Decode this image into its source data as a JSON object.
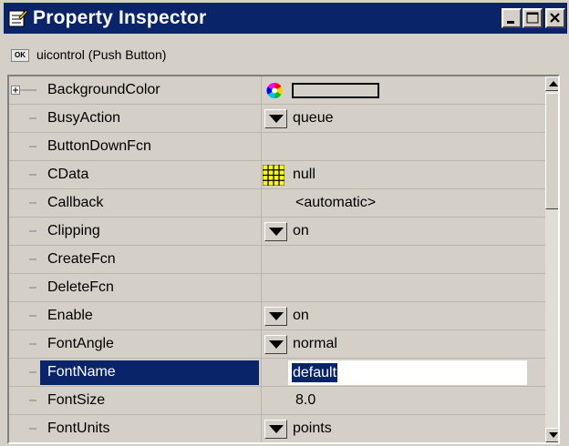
{
  "window": {
    "title": "Property Inspector"
  },
  "object": {
    "label": "uicontrol (Push Button)",
    "icon_text": "OK"
  },
  "properties": [
    {
      "name": "BackgroundColor",
      "value": "",
      "control": "color"
    },
    {
      "name": "BusyAction",
      "value": "queue",
      "control": "dropdown"
    },
    {
      "name": "ButtonDownFcn",
      "value": "",
      "control": "none"
    },
    {
      "name": "CData",
      "value": "null",
      "control": "grid"
    },
    {
      "name": "Callback",
      "value": "<automatic>",
      "control": "none"
    },
    {
      "name": "Clipping",
      "value": "on",
      "control": "dropdown"
    },
    {
      "name": "CreateFcn",
      "value": "",
      "control": "none"
    },
    {
      "name": "DeleteFcn",
      "value": "",
      "control": "none"
    },
    {
      "name": "Enable",
      "value": "on",
      "control": "dropdown"
    },
    {
      "name": "FontAngle",
      "value": "normal",
      "control": "dropdown"
    },
    {
      "name": "FontName",
      "value": "default",
      "control": "edit",
      "selected": true
    },
    {
      "name": "FontSize",
      "value": "8.0",
      "control": "none"
    },
    {
      "name": "FontUnits",
      "value": "points",
      "control": "dropdown"
    }
  ],
  "colors": {
    "titlebar": "#0a246a",
    "selection": "#0a246a",
    "face": "#d4d0c8"
  },
  "icons": {
    "app": "property-inspector-icon",
    "color": "color-wheel-icon",
    "cdata": "grid-icon",
    "dropdown": "dropdown-arrow-icon"
  }
}
